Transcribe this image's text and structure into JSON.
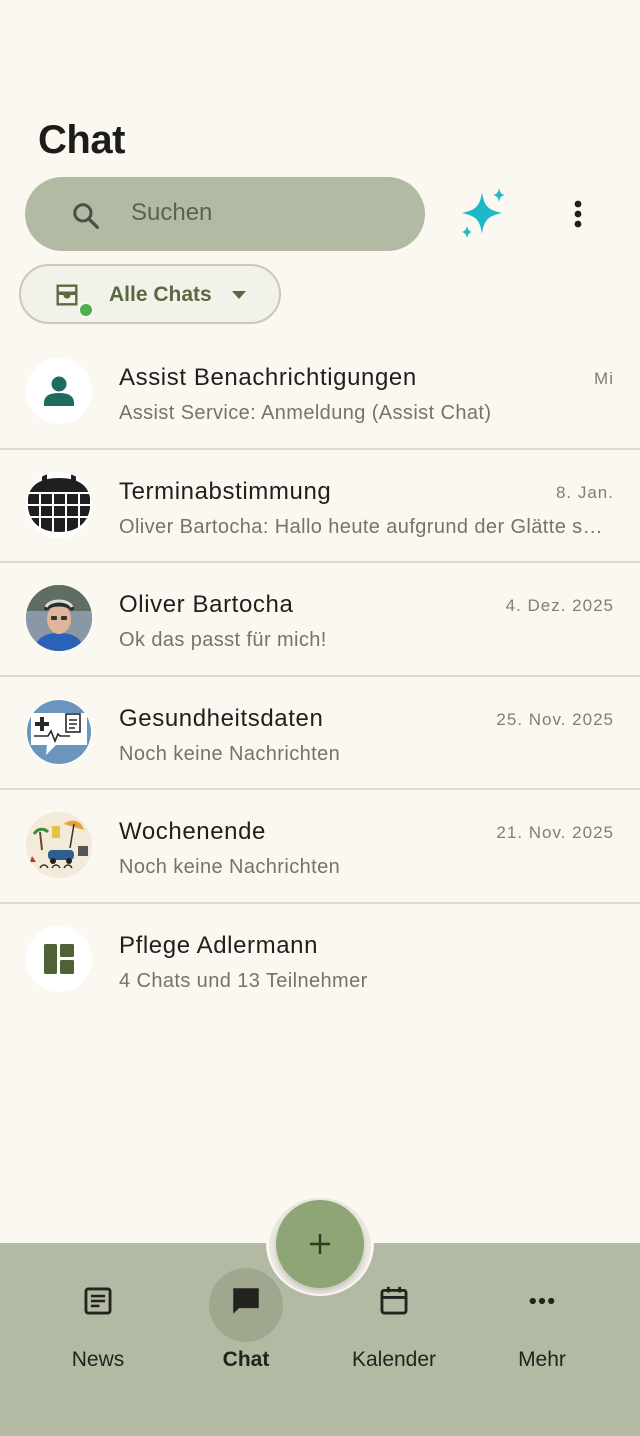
{
  "header": {
    "title": "Chat"
  },
  "search": {
    "placeholder": "Suchen"
  },
  "filter": {
    "label": "Alle Chats"
  },
  "chats": [
    {
      "name": "Assist Benachrichtigungen",
      "preview": "Assist Service: Anmeldung (Assist Chat)",
      "date": "Mi",
      "avatar": "person-icon"
    },
    {
      "name": "Terminabstimmung",
      "preview": "Oliver Bartocha: Hallo heute aufgrund der Glätte sind alle Termine verschoben",
      "date": "8. Jan.",
      "avatar": "calendar-grid-icon"
    },
    {
      "name": "Oliver Bartocha",
      "preview": "Ok das passt für mich!",
      "date": "4. Dez. 2025",
      "avatar": "user-photo",
      "online": true
    },
    {
      "name": "Gesundheitsdaten",
      "preview": "Noch keine Nachrichten",
      "date": "25. Nov. 2025",
      "avatar": "health-chat-icon"
    },
    {
      "name": "Wochenende",
      "preview": "Noch keine Nachrichten",
      "date": "21. Nov. 2025",
      "avatar": "weekend-illustration"
    },
    {
      "name": "Pflege Adlermann",
      "preview": "4 Chats und 13 Teilnehmer",
      "date": "",
      "avatar": "dashboard-icon"
    }
  ],
  "nav": {
    "items": [
      {
        "label": "News",
        "icon": "article-icon"
      },
      {
        "label": "Chat",
        "icon": "chat-bubble-icon",
        "active": true
      },
      {
        "label": "Kalender",
        "icon": "calendar-icon"
      },
      {
        "label": "Mehr",
        "icon": "more-horiz-icon"
      }
    ]
  },
  "colors": {
    "background": "#fbf8f1",
    "accent": "#b3baa3",
    "fab": "#8ea676",
    "sparkle": "#1fb8c8",
    "online": "#4caf50"
  }
}
